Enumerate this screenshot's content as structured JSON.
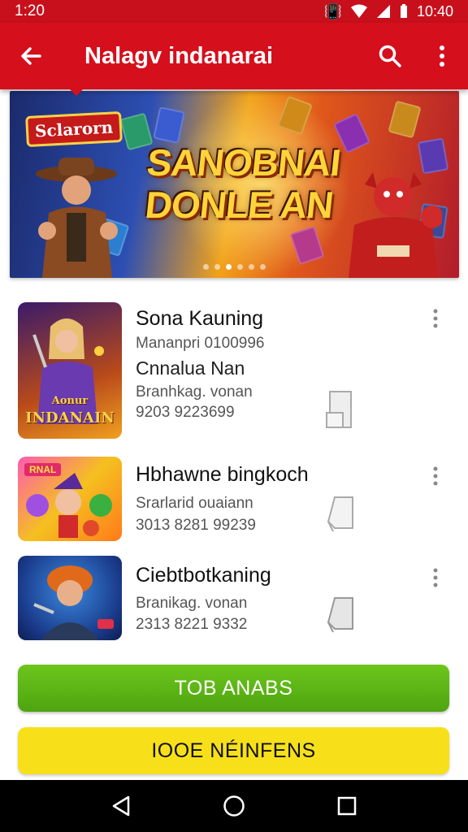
{
  "status_bar": {
    "time": "1:20",
    "clock": "10:40"
  },
  "app_bar": {
    "title": "Nalagv indanarai",
    "back_icon": "arrow-left-icon",
    "search_icon": "search-icon",
    "menu_icon": "more-vert-icon"
  },
  "banner": {
    "badge": "Sclarorn",
    "title_line1": "SANOBNAI",
    "title_line2": "DONLE AN",
    "slide_count": 6,
    "active_slide": 2
  },
  "items": [
    {
      "title": "Sona Kauning",
      "line1": "Mananpri 0100996",
      "line2": "Cnnalua Nan",
      "line3": "Branhkag. vonan",
      "line4": "9203 9223699",
      "thumb_caption_top": "Aonur",
      "thumb_caption": "INDANAIN"
    },
    {
      "title": "Hbhawne bingkoch",
      "line1": "Srarlarid ouaiann",
      "line2": "3013 8281 99239",
      "thumb_caption": "RNAL"
    },
    {
      "title": "Ciebtbotkaning",
      "line1": "Branikag. vonan",
      "line2": "2313 8221 9332"
    }
  ],
  "buttons": {
    "primary": "TOB ANABS",
    "secondary": "IOOE NÉINFENS"
  },
  "colors": {
    "app_bar": "#d50f1c",
    "primary_button": "#5ab514",
    "secondary_button": "#f7e01a"
  }
}
